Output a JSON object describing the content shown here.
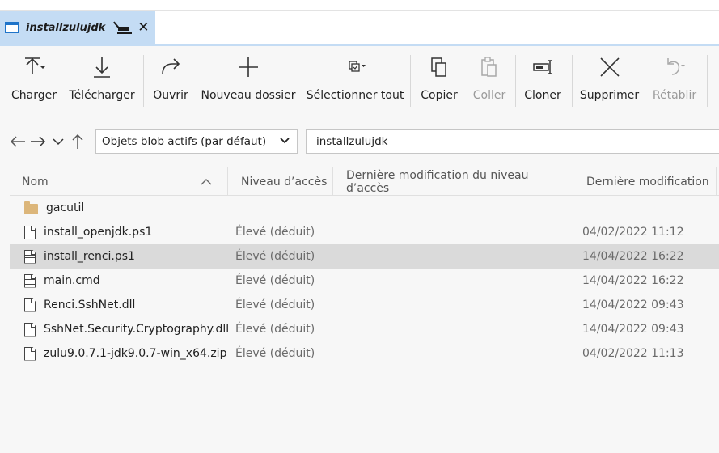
{
  "tab": {
    "title": "installzulujdk",
    "close": "✕"
  },
  "toolbar": {
    "charger": "Charger",
    "telecharger": "Télécharger",
    "ouvrir": "Ouvrir",
    "nouveau_dossier": "Nouveau dossier",
    "selectionner_tout": "Sélectionner tout",
    "copier": "Copier",
    "coller": "Coller",
    "cloner": "Cloner",
    "supprimer": "Supprimer",
    "retablir": "Rétablir"
  },
  "nav": {
    "container_select": "Objets blob actifs (par défaut)",
    "path": "installzulujdk"
  },
  "columns": {
    "name": "Nom",
    "access_level": "Niveau d’accès",
    "access_modified": "Dernière modification du niveau d’accès",
    "last_modified": "Dernière modification"
  },
  "rows": [
    {
      "name": "gacutil",
      "type": "folder",
      "access": "",
      "date": ""
    },
    {
      "name": "install_openjdk.ps1",
      "type": "file",
      "access": "Élevé (déduit)",
      "date": "04/02/2022 11:12"
    },
    {
      "name": "install_renci.ps1",
      "type": "file-lines",
      "access": "Élevé (déduit)",
      "date": "14/04/2022 16:22",
      "selected": true
    },
    {
      "name": "main.cmd",
      "type": "file-lines",
      "access": "Élevé (déduit)",
      "date": "14/04/2022 16:22"
    },
    {
      "name": "Renci.SshNet.dll",
      "type": "file",
      "access": "Élevé (déduit)",
      "date": "14/04/2022 09:43"
    },
    {
      "name": "SshNet.Security.Cryptography.dll",
      "type": "file",
      "access": "Élevé (déduit)",
      "date": "14/04/2022 09:43"
    },
    {
      "name": "zulu9.0.7.1-jdk9.0.7-win_x64.zip",
      "type": "file",
      "access": "Élevé (déduit)",
      "date": "04/02/2022 11:13"
    }
  ]
}
